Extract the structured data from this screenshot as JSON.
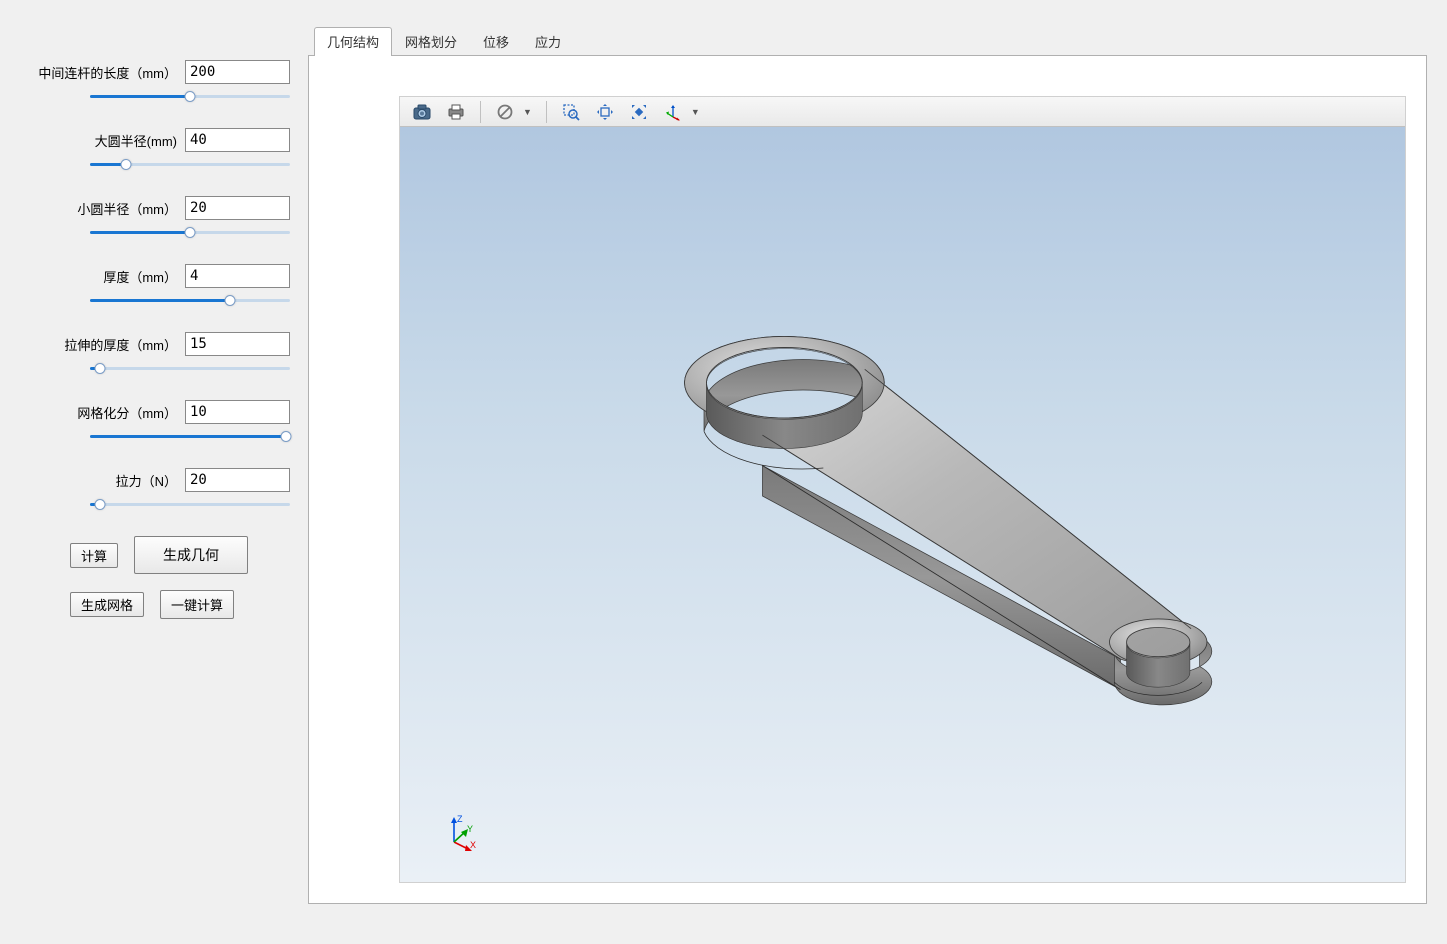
{
  "params": [
    {
      "label": "中间连杆的长度（mm）",
      "value": "200",
      "slider_pct": 50
    },
    {
      "label": "大圆半径(mm)",
      "value": "40",
      "slider_pct": 18
    },
    {
      "label": "小圆半径（mm）",
      "value": "20",
      "slider_pct": 50
    },
    {
      "label": "厚度（mm）",
      "value": "4",
      "slider_pct": 70
    },
    {
      "label": "拉伸的厚度（mm）",
      "value": "15",
      "slider_pct": 5
    },
    {
      "label": "网格化分（mm）",
      "value": "10",
      "slider_pct": 98
    },
    {
      "label": "拉力（N）",
      "value": "20",
      "slider_pct": 5
    }
  ],
  "buttons": {
    "compute": "计算",
    "generate_geometry": "生成几何",
    "generate_mesh": "生成网格",
    "one_click": "一键计算"
  },
  "tabs": [
    {
      "label": "几何结构",
      "active": true
    },
    {
      "label": "网格划分",
      "active": false
    },
    {
      "label": "位移",
      "active": false
    },
    {
      "label": "应力",
      "active": false
    }
  ],
  "toolbar_icons": [
    "camera-icon",
    "print-icon",
    "block-icon",
    "zoom-area-icon",
    "pan-icon",
    "fit-icon",
    "axis-rotate-icon"
  ],
  "axis_labels": {
    "x": "X",
    "y": "Y",
    "z": "Z"
  }
}
